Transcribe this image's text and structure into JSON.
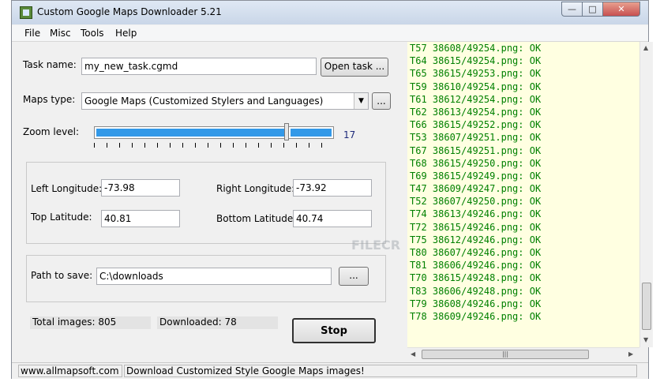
{
  "window": {
    "title": "Custom Google Maps Downloader 5.21"
  },
  "menu": [
    "File",
    "Misc",
    "Tools",
    "Help"
  ],
  "task": {
    "label": "Task name:",
    "value": "my_new_task.cgmd",
    "open_button": "Open task ..."
  },
  "maps_type": {
    "label": "Maps type:",
    "selected": "Google Maps (Customized Stylers and Languages)",
    "browse_button": "..."
  },
  "zoom": {
    "label": "Zoom level:",
    "value": "17"
  },
  "coords": {
    "left_longitude_label": "Left Longitude:",
    "left_longitude": "-73.98",
    "right_longitude_label": "Right Longitude:",
    "right_longitude": "-73.92",
    "top_latitude_label": "Top Latitude:",
    "top_latitude": "40.81",
    "bottom_latitude_label": "Bottom Latitude:",
    "bottom_latitude": "40.74"
  },
  "path": {
    "label": "Path to save:",
    "value": "C:\\downloads",
    "browse_button": "..."
  },
  "stats": {
    "total": "Total images: 805",
    "downloaded": "Downloaded: 78"
  },
  "stop_button": "Stop",
  "log": [
    "T57 38608/49254.png: OK",
    "T64 38615/49254.png: OK",
    "T65 38615/49253.png: OK",
    "T59 38610/49254.png: OK",
    "T61 38612/49254.png: OK",
    "T62 38613/49254.png: OK",
    "T66 38615/49252.png: OK",
    "T53 38607/49251.png: OK",
    "T67 38615/49251.png: OK",
    "T68 38615/49250.png: OK",
    "T69 38615/49249.png: OK",
    "T47 38609/49247.png: OK",
    "T52 38607/49250.png: OK",
    "T74 38613/49246.png: OK",
    "T72 38615/49246.png: OK",
    "T75 38612/49246.png: OK",
    "T80 38607/49246.png: OK",
    "T81 38606/49246.png: OK",
    "T70 38615/49248.png: OK",
    "T83 38606/49248.png: OK",
    "T79 38608/49246.png: OK",
    "T78 38609/49246.png: OK"
  ],
  "statusbar": {
    "website": "www.allmapsoft.com",
    "message": "Download Customized Style Google Maps images!"
  },
  "watermark": "FILECR"
}
